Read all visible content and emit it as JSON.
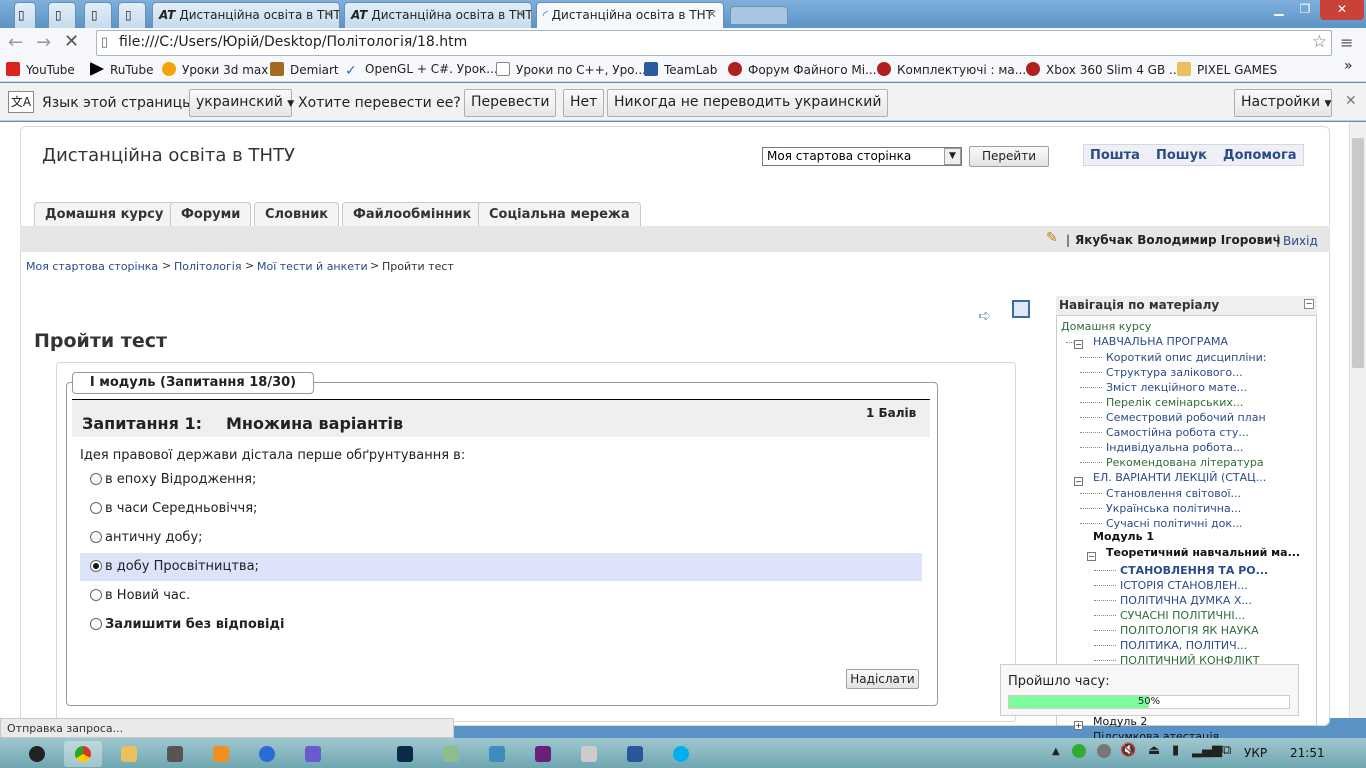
{
  "browser": {
    "tabs": [
      {
        "label": "Дистанційна освіта в ТНТ",
        "icon": "at-icon"
      },
      {
        "label": "Дистанційна освіта в ТНТ",
        "icon": "at-icon"
      },
      {
        "label": "Дистанційна освіта в ТНТ",
        "icon": "loading-icon"
      }
    ],
    "url": "file:///C:/Users/Юрій/Desktop/Політологія/18.htm",
    "bookmarks": [
      "YouTube",
      "RuTube",
      "Уроки 3d max",
      "Demiart",
      "OpenGL + C#. Урок...",
      "Уроки по C++, Уро...",
      "TeamLab",
      "Форум Файного Мі...",
      "Комплектуючі : ма...",
      "Xbox 360 Slim 4 GB ...",
      "PIXEL GAMES"
    ],
    "status": "Отправка запроса..."
  },
  "translate": {
    "label": "Язык этой страницы",
    "language": "украинский",
    "question": "Хотите перевести ее?",
    "translate_btn": "Перевести",
    "no_btn": "Нет",
    "never_btn": "Никогда не переводить украинский",
    "settings_btn": "Настройки"
  },
  "site": {
    "title": "Дистанційна освіта в ТНТУ",
    "jump_select": "Моя стартова сторінка",
    "jump_button": "Перейти",
    "header_links": [
      "Пошта",
      "Пошук",
      "Допомога"
    ],
    "nav_tabs": [
      "Домашня курсу",
      "Форуми",
      "Словник",
      "Файлообмінник",
      "Соціальна мережа"
    ],
    "user_name": "Якубчак Володимир Ігорович",
    "logout": "Вихід",
    "breadcrumb": [
      "Моя стартова сторінка",
      "Політологія",
      "Мої тести й анкети",
      "Пройти тест"
    ]
  },
  "quiz": {
    "page_title": "Пройти тест",
    "legend": "І модуль (Запитання 18/30)",
    "question_number": "Запитання 1:",
    "question_type": "Множина варіантів",
    "grade": "1 Балів",
    "question_text": "Ідея правової держави дістала перше обґрунтування в:",
    "options": [
      {
        "label": "в епоху Відродження;",
        "selected": false
      },
      {
        "label": "в часи Середньовіччя;",
        "selected": false
      },
      {
        "label": "античну добу;",
        "selected": false
      },
      {
        "label": "в добу Просвітництва;",
        "selected": true
      },
      {
        "label": "в Новий час.",
        "selected": false
      },
      {
        "label": "Залишити без відповіді",
        "selected": false
      }
    ],
    "submit": "Надіслати"
  },
  "navigation": {
    "title": "Навігація по матеріалу",
    "items": [
      "Домашня курсу",
      "НАВЧАЛЬНА ПРОГРАМА",
      "Короткий опис дисципліни:",
      "Структура залікового...",
      "Зміст лекційного мате...",
      "Перелік семінарських...",
      "Семестровий робочий план",
      "Самостійна робота сту...",
      "Індивідуальна робота...",
      "Рекомендована література",
      "ЕЛ. ВАРІАНТИ ЛЕКЦІЙ (СТАЦ...",
      "Становлення світової...",
      "Українська політична...",
      "Сучасні політичні док...",
      "Модуль 1",
      "Теоретичний навчальний ма...",
      "СТАНОВЛЕННЯ ТА РО...",
      "ІСТОРІЯ СТАНОВЛЕН...",
      "ПОЛІТИЧНА ДУМКА Х...",
      "СУЧАСНІ ПОЛІТИЧНІ...",
      "ПОЛІТОЛОГІЯ ЯК НАУКА",
      "ПОЛІТИКА, ПОЛІТИЧ...",
      "ПОЛІТИЧНИЙ КОНФЛІКТ",
      "Модуль 2",
      "Підсумкова атестація"
    ]
  },
  "timer": {
    "label": "Пройшло часу:",
    "percent_text": "50%",
    "fraction": 0.5
  },
  "taskbar": {
    "lang": "УКР",
    "time": "21:51"
  },
  "colors": {
    "frame": "#5b93c6",
    "selected_option": "#dde4fa",
    "timer_fill": "#7cfc9a",
    "link": "#2a4a8a"
  }
}
